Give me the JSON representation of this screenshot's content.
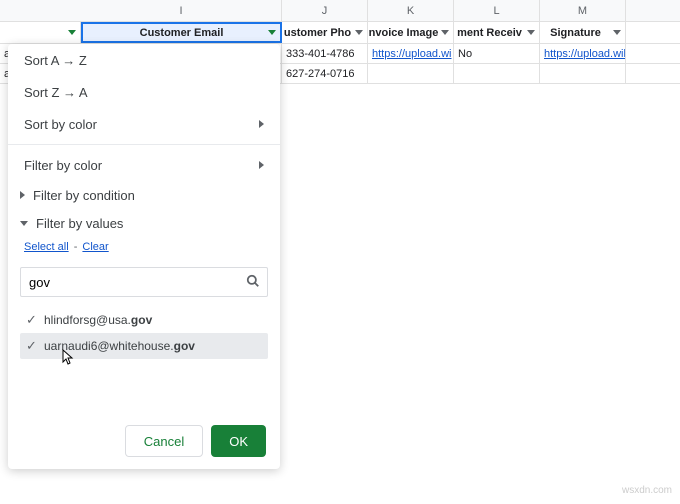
{
  "columns": {
    "I": "I",
    "J": "J",
    "K": "K",
    "L": "L",
    "M": "M"
  },
  "fields": {
    "I": "Customer Email",
    "J": "ustomer Pho",
    "K": "nvoice Image",
    "L": "ment Receiv",
    "M": "Signature"
  },
  "rows": [
    {
      "left": "a,",
      "J": "333-401-4786",
      "K": "https://upload.wi",
      "L": "No",
      "M": "https://upload.wikimedia."
    },
    {
      "left": "a,",
      "J": "627-274-0716",
      "K": "",
      "L": "",
      "M": ""
    }
  ],
  "menu": {
    "sort_az": "Sort A → Z",
    "sort_za": "Sort Z → A",
    "sort_color": "Sort by color",
    "filter_color": "Filter by color",
    "filter_condition": "Filter by condition",
    "filter_values": "Filter by values"
  },
  "select_all": "Select all",
  "clear": "Clear",
  "search_value": "gov",
  "values": [
    {
      "prefix": "hlindforsg@usa.",
      "match": "gov"
    },
    {
      "prefix": "uarnaudi6@whitehouse.",
      "match": "gov"
    }
  ],
  "buttons": {
    "cancel": "Cancel",
    "ok": "OK"
  },
  "watermark": "wsxdn.com"
}
